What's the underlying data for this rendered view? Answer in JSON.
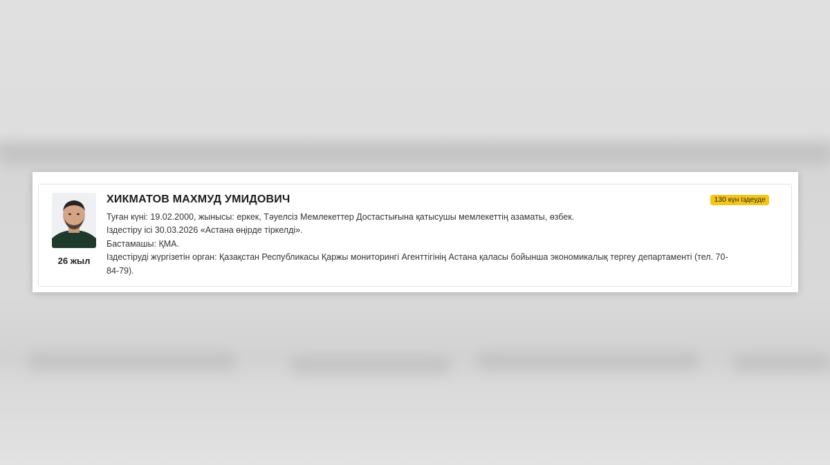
{
  "person": {
    "name": "ХИКМАТОВ МАХМУД УМИДОВИЧ",
    "age_label": "26 жыл",
    "status_badge": "130 күн іздеуде",
    "details": [
      "Туған күні: 19.02.2000, жынысы: еркек, Тәуелсіз Мемлекеттер Достастығына қатысушы мемлекеттің азаматы, өзбек.",
      "Іздестіру ісі 30.03.2026 «Астана өңірде тіркелді».",
      "Бастамашы: ҚМА.",
      "Іздестіруді жүргізетін орган: Қазақстан Республикасы Қаржы мониторингі Агенттігінің Астана қаласы бойынша экономикалық тергеу департаменті (тел. 70-",
      "84-79)."
    ]
  },
  "colors": {
    "badge_bg": "#f5c518",
    "card_bg": "#ffffff",
    "page_bg": "#dcdcdc"
  },
  "icons": {
    "photo": "person-photo"
  }
}
